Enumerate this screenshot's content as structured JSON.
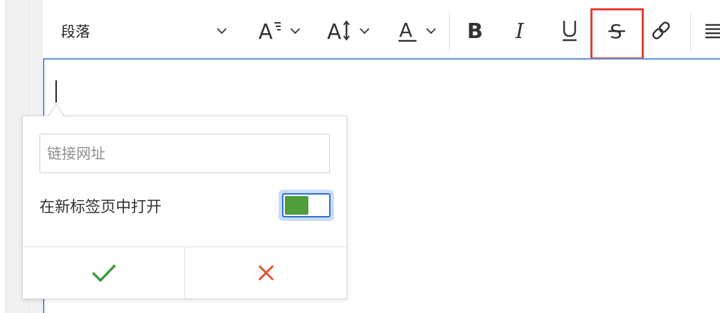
{
  "toolbar": {
    "paragraph_label": "段落",
    "font_size_icon": "font-size-icon",
    "line_height_icon": "line-height-icon",
    "font_color_icon": "font-color-icon",
    "bold_icon": "bold-icon",
    "italic_icon": "italic-icon",
    "underline_icon": "underline-icon",
    "strikethrough_icon": "strikethrough-icon",
    "link_icon": "link-icon",
    "align_icon": "align-icon",
    "highlight_color": "#e53b2f"
  },
  "link_popover": {
    "url_placeholder": "链接网址",
    "url_value": "",
    "new_tab_label": "在新标签页中打开",
    "new_tab_enabled": true,
    "confirm_icon": "check-icon",
    "cancel_icon": "close-icon"
  },
  "colors": {
    "toggle_on": "#4f9e3b",
    "confirm": "#3c9a3c",
    "cancel": "#e0502f",
    "editor_focus": "#5f8fd6"
  }
}
